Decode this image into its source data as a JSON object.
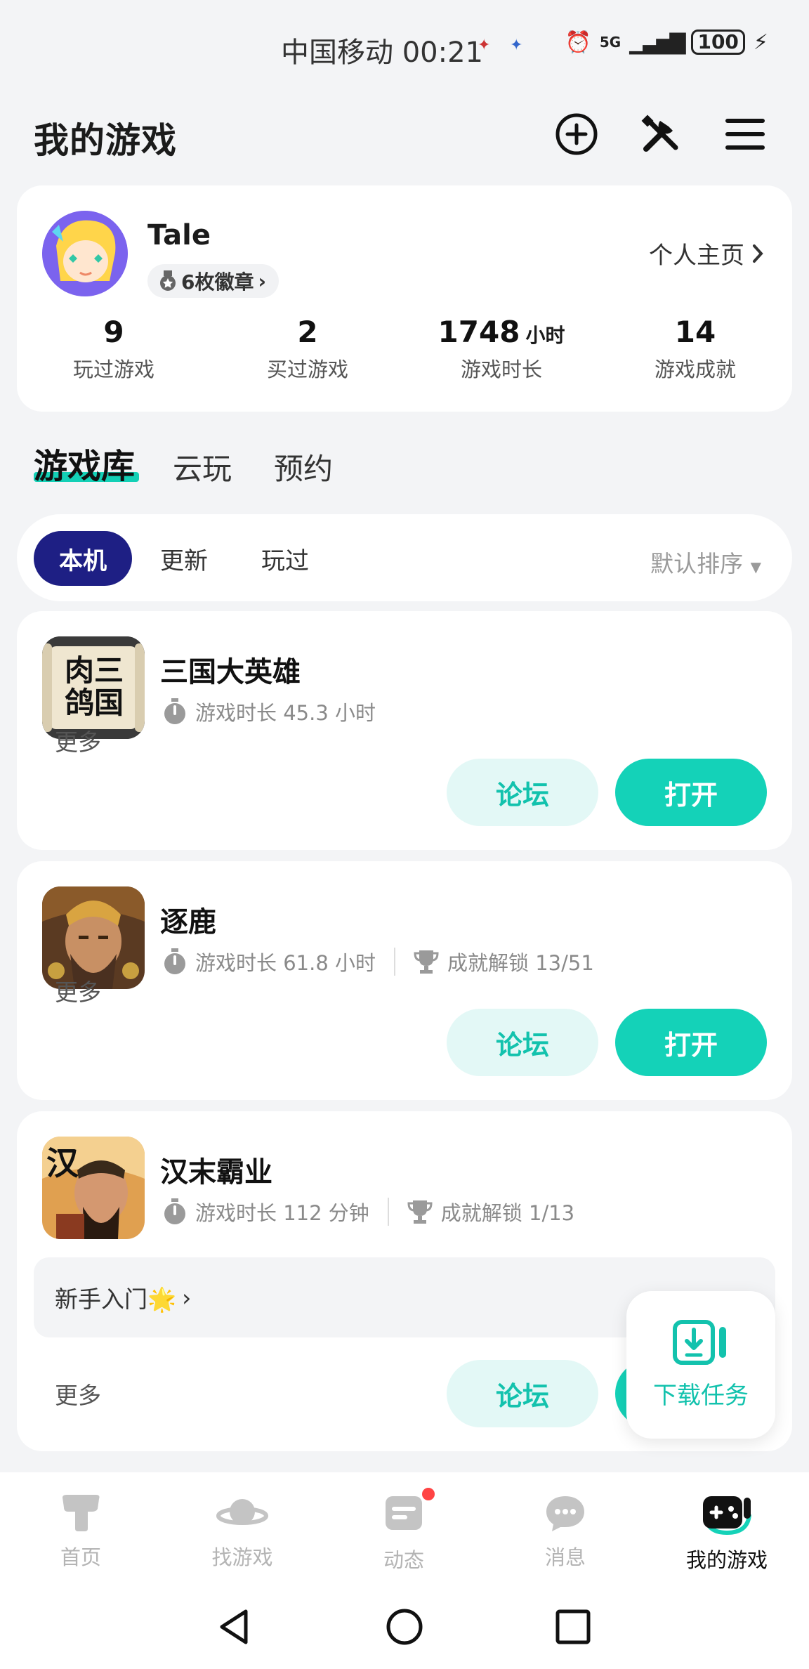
{
  "status_bar": {
    "carrier_time": "中国移动 00:21",
    "network": "5G",
    "battery": "100"
  },
  "header": {
    "title": "我的游戏",
    "add_icon": "plus-circle-icon",
    "tools_icon": "tools-icon",
    "menu_icon": "menu-icon"
  },
  "profile": {
    "username": "Tale",
    "badges": "6枚徽章",
    "homepage_link": "个人主页",
    "stats": [
      {
        "value": "9",
        "unit": "",
        "label": "玩过游戏"
      },
      {
        "value": "2",
        "unit": "",
        "label": "买过游戏"
      },
      {
        "value": "1748",
        "unit": "小时",
        "label": "游戏时长"
      },
      {
        "value": "14",
        "unit": "",
        "label": "游戏成就"
      }
    ]
  },
  "main_tabs": [
    "游戏库",
    "云玩",
    "预约"
  ],
  "filters": {
    "chips": [
      "本机",
      "更新",
      "玩过"
    ],
    "active": "本机",
    "sort": "默认排序"
  },
  "games": [
    {
      "name": "三国大英雄",
      "playtime": "游戏时长 45.3 小时",
      "achievement": "",
      "more": "更多",
      "forum": "论坛",
      "open": "打开",
      "icon_text": "肉三鸽国"
    },
    {
      "name": "逐鹿",
      "playtime": "游戏时长 61.8 小时",
      "achievement": "成就解锁 13/51",
      "more": "更多",
      "forum": "论坛",
      "open": "打开"
    },
    {
      "name": "汉末霸业",
      "playtime": "游戏时长 112 分钟",
      "achievement": "成就解锁 1/13",
      "guide": "新手入门🌟",
      "more": "更多",
      "forum": "论坛",
      "icon_text": "汉"
    }
  ],
  "download_fab": {
    "label": "下载任务"
  },
  "bottom_nav": [
    {
      "label": "首页",
      "icon": "home-icon"
    },
    {
      "label": "找游戏",
      "icon": "planet-icon"
    },
    {
      "label": "动态",
      "icon": "feed-icon"
    },
    {
      "label": "消息",
      "icon": "message-icon"
    },
    {
      "label": "我的游戏",
      "icon": "gamepad-icon"
    }
  ],
  "colors": {
    "accent": "#14d2b8",
    "active_chip": "#1e1f84",
    "background": "#f3f4f6"
  }
}
